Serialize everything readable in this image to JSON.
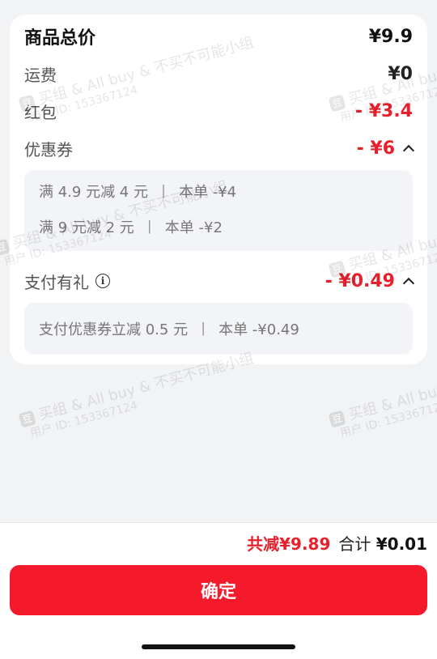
{
  "summary": {
    "title": "商品总价",
    "title_value": "¥9.9",
    "shipping_label": "运费",
    "shipping_value": "¥0",
    "redpacket_label": "红包",
    "redpacket_value": "- ¥3.4",
    "coupon_label": "优惠券",
    "coupon_value": "- ¥6",
    "coupons": [
      {
        "rule": "满 4.9 元减 4 元",
        "sep": "丨",
        "this_order": "本单 -¥4"
      },
      {
        "rule": "满 9 元减 2 元",
        "sep": "丨",
        "this_order": "本单 -¥2"
      }
    ],
    "pay_label": "支付有礼",
    "pay_info_icon": "i",
    "pay_value": "- ¥0.49",
    "pay_items": [
      {
        "rule": "支付优惠券立减 0.5 元",
        "sep": "丨",
        "this_order": "本单 -¥0.49"
      }
    ]
  },
  "footer": {
    "reduce_text": "共减¥9.89",
    "total_label": "合计",
    "total_value": "¥0.01",
    "confirm_label": "确定"
  },
  "watermark": {
    "logo": "豆",
    "line1": "买组 & All buy & 不买不可能小组",
    "line2": "用户 ID: 153367124"
  },
  "colors": {
    "accent_red": "#e8202d",
    "button_red": "#f5192c",
    "background": "#f2f3f5"
  }
}
